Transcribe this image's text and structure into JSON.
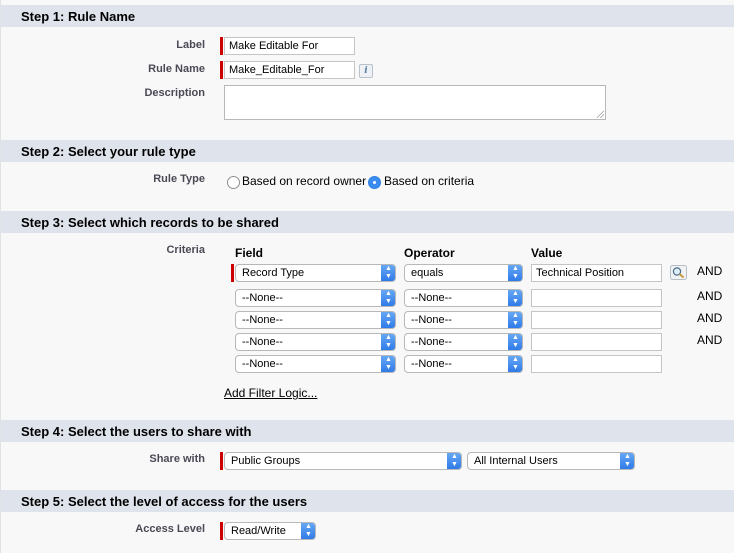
{
  "step1": {
    "header": "Step 1: Rule Name",
    "label_label": "Label",
    "label_value": "Make Editable For",
    "rule_name_label": "Rule Name",
    "rule_name_value": "Make_Editable_For",
    "description_label": "Description",
    "info_icon": "i"
  },
  "step2": {
    "header": "Step 2: Select your rule type",
    "rule_type_label": "Rule Type",
    "options": [
      {
        "label": "Based on record owner",
        "selected": false
      },
      {
        "label": "Based on criteria",
        "selected": true
      }
    ]
  },
  "step3": {
    "header": "Step 3: Select which records to be shared",
    "criteria_label": "Criteria",
    "columns": {
      "field": "Field",
      "operator": "Operator",
      "value": "Value"
    },
    "rows": [
      {
        "field": "Record Type",
        "operator": "equals",
        "value": "Technical Position",
        "conj": "AND"
      },
      {
        "field": "--None--",
        "operator": "--None--",
        "value": "",
        "conj": "AND"
      },
      {
        "field": "--None--",
        "operator": "--None--",
        "value": "",
        "conj": "AND"
      },
      {
        "field": "--None--",
        "operator": "--None--",
        "value": "",
        "conj": "AND"
      },
      {
        "field": "--None--",
        "operator": "--None--",
        "value": "",
        "conj": ""
      }
    ],
    "add_filter_logic": "Add Filter Logic..."
  },
  "step4": {
    "header": "Step 4: Select the users to share with",
    "share_with_label": "Share with",
    "share_type": "Public Groups",
    "share_target": "All Internal Users"
  },
  "step5": {
    "header": "Step 5: Select the level of access for the users",
    "access_level_label": "Access Level",
    "access_level": "Read/Write"
  },
  "colors": {
    "header_bg": "#dfe3ec",
    "required": "#cc0000",
    "select_accent": "#2b78e8"
  },
  "icons": {
    "lookup": "magnifier-icon",
    "select_arrow": "up-down-chevron-icon",
    "info": "info-icon"
  }
}
